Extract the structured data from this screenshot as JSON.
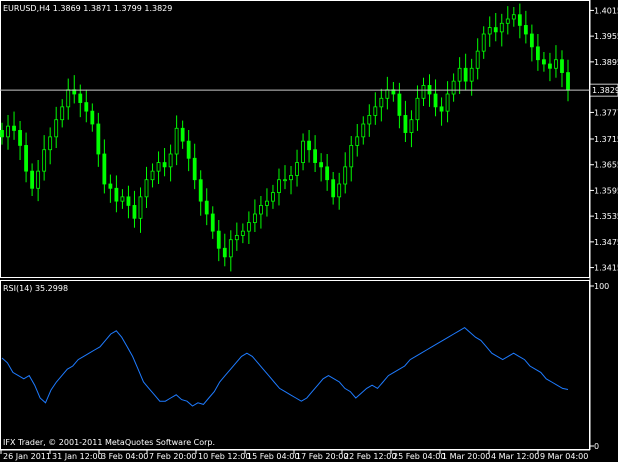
{
  "window": {
    "header": "EURUSD,H4  1.3869 1.3871 1.3799 1.3829",
    "copyright": "IFX Trader, © 2001-2011 MetaQuotes Software Corp."
  },
  "colors": {
    "background": "#000000",
    "candle": "#00ff00",
    "rsi_line": "#1e7bff",
    "price_line": "#c8c8c8",
    "axis": "#ffffff"
  },
  "chart_data": [
    {
      "type": "candlestick",
      "symbol": "EURUSD",
      "timeframe": "H4",
      "ohlc_last": {
        "open": 1.3869,
        "high": 1.3871,
        "low": 1.3799,
        "close": 1.3829
      },
      "current_price_label": "1.3829",
      "ylim": [
        1.34,
        1.403
      ],
      "y_ticks": [
        "1.4015",
        "1.3955",
        "1.3895",
        "1.3777",
        "1.3715",
        "1.3655",
        "1.3595",
        "1.3535",
        "1.3475",
        "1.3415"
      ],
      "close_path": [
        1.372,
        1.3745,
        1.3735,
        1.37,
        1.364,
        1.36,
        1.364,
        1.369,
        1.372,
        1.376,
        1.379,
        1.383,
        1.382,
        1.38,
        1.378,
        1.375,
        1.368,
        1.361,
        1.36,
        1.357,
        1.358,
        1.356,
        1.353,
        1.358,
        1.362,
        1.364,
        1.366,
        1.365,
        1.368,
        1.374,
        1.371,
        1.367,
        1.362,
        1.357,
        1.354,
        1.35,
        1.346,
        1.344,
        1.348,
        1.349,
        1.35,
        1.352,
        1.354,
        1.356,
        1.357,
        1.359,
        1.362,
        1.362,
        1.363,
        1.366,
        1.371,
        1.369,
        1.366,
        1.365,
        1.362,
        1.358,
        1.361,
        1.365,
        1.37,
        1.372,
        1.375,
        1.377,
        1.379,
        1.381,
        1.383,
        1.382,
        1.377,
        1.373,
        1.376,
        1.381,
        1.384,
        1.382,
        1.379,
        1.378,
        1.382,
        1.385,
        1.388,
        1.385,
        1.388,
        1.392,
        1.396,
        1.3975,
        1.3965,
        1.3985,
        1.3995,
        1.4005,
        1.398,
        1.396,
        1.393,
        1.39,
        1.389,
        1.388,
        1.39,
        1.387,
        1.3829
      ]
    },
    {
      "type": "line",
      "indicator": "RSI(14)",
      "value": 35.2998,
      "label": "RSI(14) 35.2998",
      "ylim": [
        0,
        100
      ],
      "y_ticks": [
        "100",
        "0"
      ],
      "values": [
        55,
        52,
        46,
        44,
        42,
        44,
        38,
        30,
        27,
        35,
        40,
        44,
        48,
        50,
        54,
        56,
        58,
        60,
        62,
        66,
        70,
        72,
        68,
        62,
        56,
        48,
        40,
        36,
        32,
        28,
        28,
        30,
        32,
        29,
        28,
        25,
        27,
        26,
        30,
        34,
        40,
        44,
        48,
        52,
        56,
        58,
        56,
        52,
        48,
        44,
        40,
        36,
        34,
        32,
        30,
        28,
        30,
        34,
        38,
        42,
        44,
        42,
        40,
        36,
        34,
        30,
        33,
        36,
        38,
        36,
        40,
        44,
        46,
        48,
        50,
        54,
        56,
        58,
        60,
        62,
        64,
        66,
        68,
        70,
        72,
        74,
        71,
        68,
        66,
        62,
        58,
        56,
        54,
        56,
        58,
        56,
        54,
        50,
        48,
        46,
        42,
        40,
        38,
        36,
        35.3
      ],
      "series": [
        {
          "name": "RSI(14)"
        }
      ]
    }
  ],
  "time_axis": [
    "26 Jan 2011",
    "31 Jan 12:00",
    "3 Feb 04:00",
    "7 Feb 20:00",
    "10 Feb 12:00",
    "15 Feb 04:00",
    "17 Feb 20:00",
    "22 Feb 12:00",
    "25 Feb 04:00",
    "1 Mar 20:00",
    "4 Mar 12:00",
    "9 Mar 04:00"
  ]
}
